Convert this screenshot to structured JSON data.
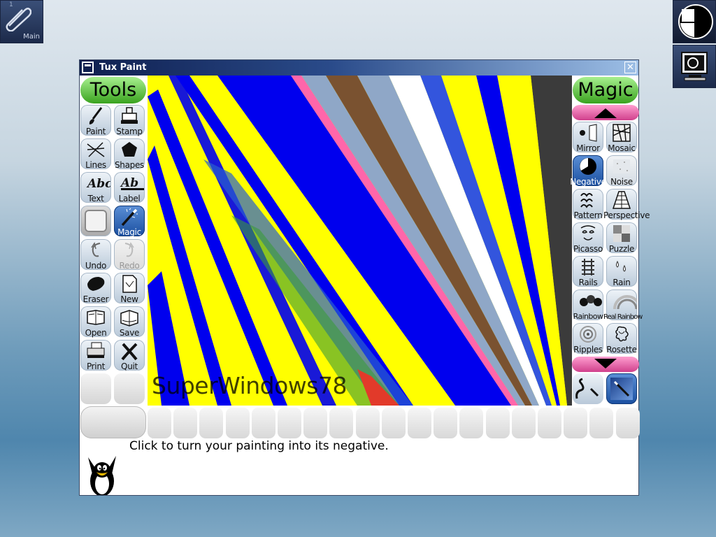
{
  "desktop": {
    "main_icon_label": "Main",
    "main_icon_corner": "1"
  },
  "window": {
    "title": "Tux Paint",
    "close_glyph": "✕"
  },
  "tools": {
    "header": "Tools",
    "items": [
      {
        "label": "Paint",
        "icon": "paintbrush-icon"
      },
      {
        "label": "Stamp",
        "icon": "rubber-stamp-icon"
      },
      {
        "label": "Lines",
        "icon": "lines-icon"
      },
      {
        "label": "Shapes",
        "icon": "pentagon-icon"
      },
      {
        "label": "Text",
        "icon": "text-abc-icon"
      },
      {
        "label": "Label",
        "icon": "label-abc-icon"
      },
      {
        "label": "",
        "icon": "blank-icon"
      },
      {
        "label": "Magic",
        "icon": "magic-wand-icon"
      },
      {
        "label": "Undo",
        "icon": "undo-icon"
      },
      {
        "label": "Redo",
        "icon": "redo-icon"
      },
      {
        "label": "Eraser",
        "icon": "eraser-icon"
      },
      {
        "label": "New",
        "icon": "new-document-icon"
      },
      {
        "label": "Open",
        "icon": "open-book-icon"
      },
      {
        "label": "Save",
        "icon": "save-book-icon"
      },
      {
        "label": "Print",
        "icon": "printer-icon"
      },
      {
        "label": "Quit",
        "icon": "quit-x-icon"
      }
    ]
  },
  "magic": {
    "header": "Magic",
    "items": [
      {
        "label": "Mirror",
        "icon": "mirror-icon"
      },
      {
        "label": "Mosaic",
        "icon": "mosaic-icon"
      },
      {
        "label": "Negative",
        "icon": "negative-icon"
      },
      {
        "label": "Noise",
        "icon": "noise-icon"
      },
      {
        "label": "Pattern",
        "icon": "pattern-icon"
      },
      {
        "label": "Perspective",
        "icon": "perspective-icon"
      },
      {
        "label": "Picasso",
        "icon": "picasso-icon"
      },
      {
        "label": "Puzzle",
        "icon": "puzzle-icon"
      },
      {
        "label": "Rails",
        "icon": "rails-icon"
      },
      {
        "label": "Rain",
        "icon": "rain-icon"
      },
      {
        "label": "Rainbow",
        "icon": "rainbow-icon"
      },
      {
        "label": "Real Rainbow",
        "icon": "real-rainbow-icon"
      },
      {
        "label": "Ripples",
        "icon": "ripples-icon"
      },
      {
        "label": "Rosette",
        "icon": "rosette-icon"
      }
    ]
  },
  "canvas": {
    "signature": "SuperWindows78",
    "stripe_colors": [
      "#ffff00",
      "#0000ee",
      "#7a5230",
      "#8fa7c7",
      "#ffffff",
      "#3355dd",
      "#3b3b3b",
      "#ff66aa"
    ]
  },
  "status": {
    "message": "Click to turn your painting into its negative."
  },
  "colors": {
    "accent_green": "#3aa31f",
    "scroll_pink": "#d0408c",
    "selected_blue": "#1a4fa0"
  }
}
